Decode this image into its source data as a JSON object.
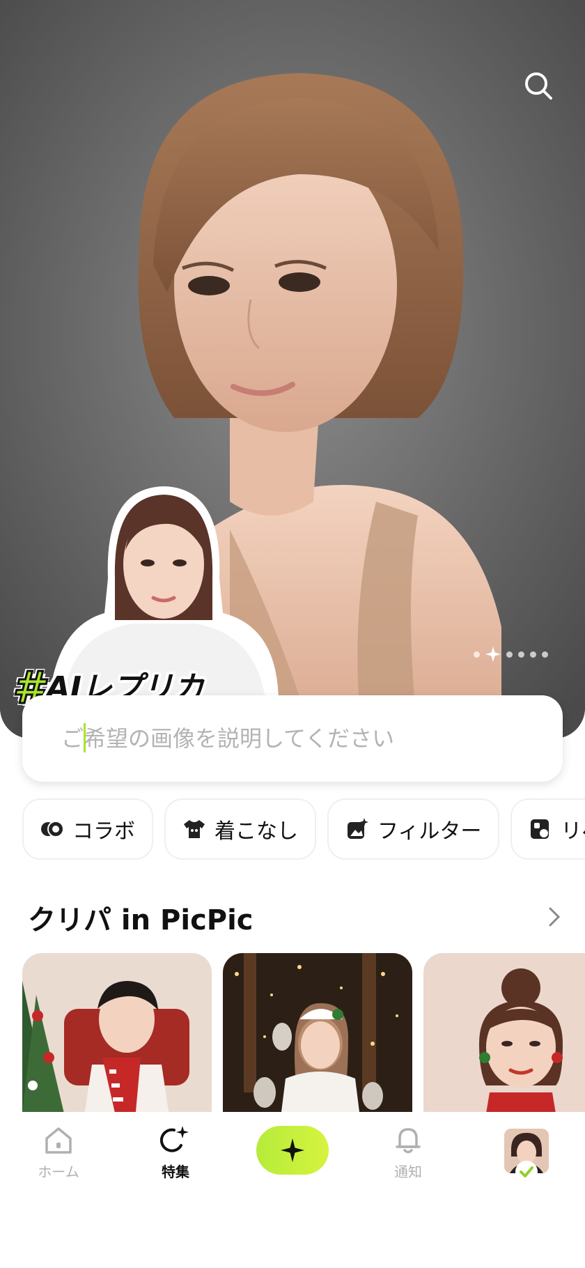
{
  "hero": {
    "tag_hash": "#",
    "tag_text": "AIレプリカ",
    "carousel_total": 6,
    "carousel_active_index": 1
  },
  "prompt": {
    "placeholder": "ご希望の画像を説明してください",
    "value": ""
  },
  "chips": [
    {
      "label": "コラボ",
      "icon": "collab-icon"
    },
    {
      "label": "着こなし",
      "icon": "tshirt-icon"
    },
    {
      "label": "フィルター",
      "icon": "filter-image-icon"
    },
    {
      "label": "リペ",
      "icon": "repaint-icon"
    }
  ],
  "section": {
    "title": "クリパ in PicPic"
  },
  "nav": {
    "home_label": "ホーム",
    "featured_label": "特集",
    "notify_label": "通知"
  },
  "colors": {
    "accent": "#a8e62a",
    "inactive": "#b0b0b0"
  }
}
